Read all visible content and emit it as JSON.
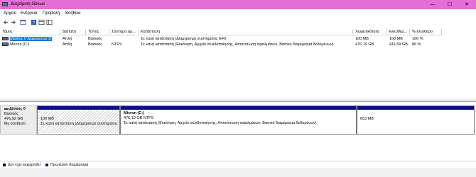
{
  "window": {
    "title": "Διαχείριση δίσκων",
    "minimize": "—",
    "maximize": "☐",
    "close": "✕"
  },
  "menu": [
    "Αρχείο",
    "Ενέργεια",
    "Προβολή",
    "Βοήθεια"
  ],
  "toolbar": [
    "back",
    "forward",
    "properties-view",
    "help",
    "show-hide",
    "console-tree"
  ],
  "volumes": {
    "headers": [
      "Τόμος",
      "Διάταξη",
      "Τύπος",
      "Σύστημα αρ...",
      "Κατάσταση",
      "Χωρητικότητα",
      "Ελεύθερ...",
      "% ελεύθερο"
    ],
    "rows": [
      {
        "volume": "(Δίσκος 0 Διαμέρισμα 1)",
        "layout": "Απλή",
        "type": "Βασικός",
        "fs": "",
        "status": "Σε καλή κατάσταση (Διαμέρισμα συστήματος EFI)",
        "capacity": "100 MB",
        "free": "100 MB",
        "pct": "100 %",
        "selected": true
      },
      {
        "volume": "Micron (C:)",
        "layout": "Απλή",
        "type": "Βασικός",
        "fs": "NTFS",
        "status": "Σε καλή κατάσταση (Εκκίνηση, Αρχείο σελιδοποίησης, Αποτύπωση σφαλμάτων, Βασικό διαμέρισμα δεδομένων)",
        "capacity": "476,19 GB",
        "free": "411,59 GB",
        "pct": "86 %",
        "selected": false
      }
    ]
  },
  "disk": {
    "name": "Δίσκος 0",
    "type": "Βασικός",
    "size": "476,92 GB",
    "state": "Με σύνδεση",
    "partitions": [
      {
        "title": "",
        "size": "100 MB",
        "status": "Σε καλή κατάσταση (Διαμέρισμα συστήματος EFI)"
      },
      {
        "title": "Micron  (C:)",
        "size": "476,19 GB NTFS",
        "status": "Σε καλή κατάσταση (Εκκίνηση, Αρχείο σελιδοποίησης, Αποτύπωση σφαλμάτων, Βασικό διαμέρισμα δεδομένων)"
      },
      {
        "title": "",
        "size": "653 MB",
        "status": ""
      }
    ]
  },
  "legend": [
    {
      "label": "Δεν έχει εκχωρηθεί",
      "color": "#000000"
    },
    {
      "label": "Πρωτεύον διαμέρισμα",
      "color": "#0a0d87"
    }
  ],
  "colors": {
    "titlebar": "#e36fd7",
    "selection": "#0078d7",
    "partition_bar": "#0a0d87"
  }
}
